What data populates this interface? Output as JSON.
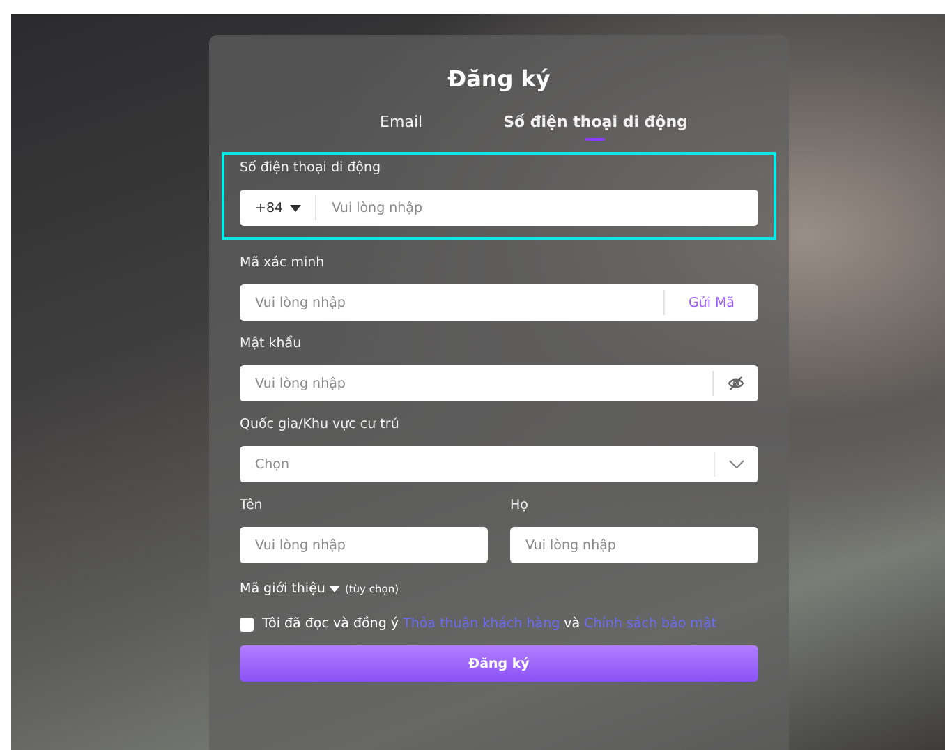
{
  "title": "Đăng ký",
  "tabs": [
    {
      "label": "Email",
      "selected": false
    },
    {
      "label": "Số điện thoại di động",
      "selected": true
    }
  ],
  "fields": [
    {
      "kind": "phone",
      "label": "Số điện thoại di động",
      "prefix": "+84",
      "placeholder": "Vui lòng nhập",
      "highlighted": true
    },
    {
      "kind": "code",
      "label": "Mã xác minh",
      "placeholder": "Vui lòng nhập",
      "action": "Gửi Mã",
      "highlighted": false
    },
    {
      "kind": "password",
      "label": "Mật khẩu",
      "placeholder": "Vui lòng nhập",
      "highlighted": false
    },
    {
      "kind": "select",
      "label": "Quốc gia/Khu vực cư trú",
      "placeholder": "Chọn",
      "highlighted": false
    }
  ],
  "name_fields": [
    {
      "label": "Tên",
      "placeholder": "Vui lòng nhập"
    },
    {
      "label": "Họ",
      "placeholder": "Vui lòng nhập"
    }
  ],
  "referral": {
    "label": "Mã giới thiệu",
    "note": "(tùy chọn)",
    "expanded": false
  },
  "agreement": {
    "checked": false,
    "parts": [
      {
        "kind": "text",
        "text": "Tôi đã đọc và đồng ý "
      },
      {
        "kind": "link",
        "text": "Thỏa thuận khách hàng"
      },
      {
        "kind": "text",
        "text": " và "
      },
      {
        "kind": "link",
        "text": "Chính sách bảo mật"
      }
    ]
  },
  "submit": "Đăng ký"
}
